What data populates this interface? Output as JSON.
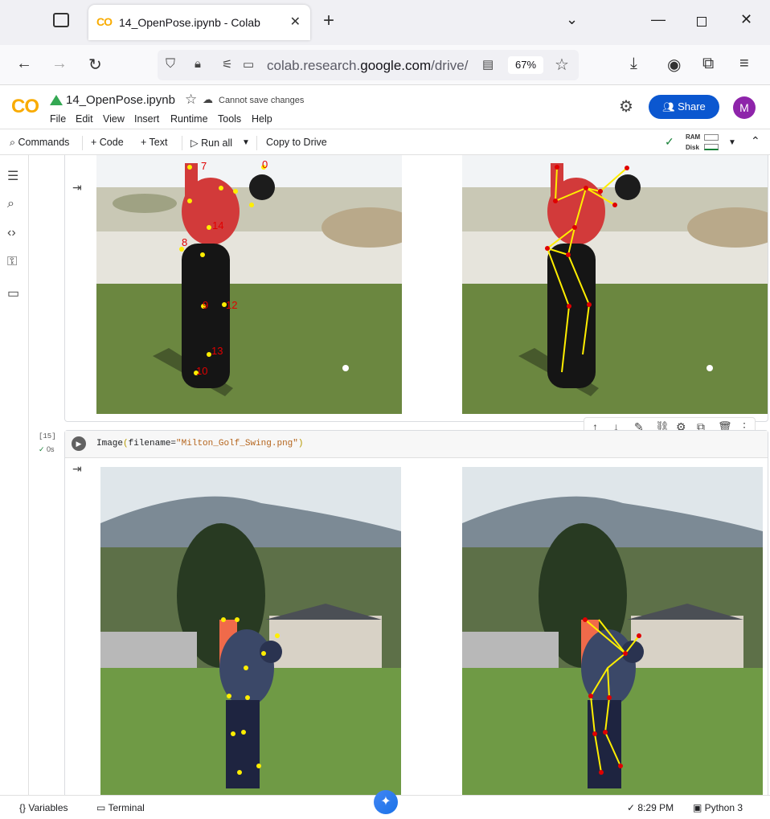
{
  "browser": {
    "tab_title": "14_OpenPose.ipynb - Colab",
    "new_tab_symbol": "+",
    "url_prefix": "colab.research.",
    "url_domain": "google.com",
    "url_suffix": "/drive/",
    "zoom": "67%"
  },
  "colab": {
    "logo_text": "CO",
    "notebook_title": "14_OpenPose.ipynb",
    "save_status": "Cannot save changes",
    "menu": [
      "File",
      "Edit",
      "View",
      "Insert",
      "Runtime",
      "Tools",
      "Help"
    ],
    "share_label": "Share",
    "avatar_letter": "M"
  },
  "toolbar": {
    "commands": "Commands",
    "code": "Code",
    "text": "Text",
    "run_all": "Run all",
    "copy_to_drive": "Copy to Drive",
    "ram": "RAM",
    "disk": "Disk"
  },
  "cells": {
    "cell1": {
      "keypoint_labels": [
        "7",
        "0",
        "14",
        "8",
        "9",
        "12",
        "13",
        "10"
      ]
    },
    "cell2": {
      "exec_count": "[15]",
      "exec_time": "0s",
      "code_fn": "Image",
      "code_arg": "filename=",
      "code_str": "\"Milton_Golf_Swing.png\"",
      "code_close": ")"
    }
  },
  "statusbar": {
    "variables": "Variables",
    "terminal": "Terminal",
    "time": "8:29 PM",
    "python": "Python 3"
  },
  "colors": {
    "accent_blue": "#0b57d0",
    "colab_orange": "#f9ab00",
    "keypoint_yellow": "#ffee00",
    "keypoint_red": "#e00000"
  }
}
